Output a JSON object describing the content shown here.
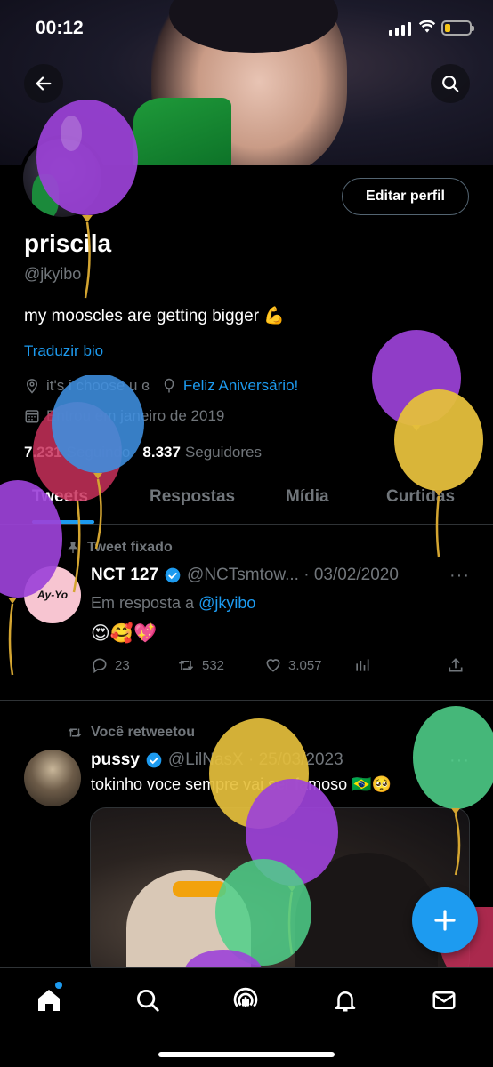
{
  "status_bar": {
    "time": "00:12"
  },
  "profile": {
    "edit_label": "Editar perfil",
    "name": "priscila",
    "handle": "@jkyibo",
    "bio": "my mooscles are getting bigger 💪",
    "translate_label": "Traduzir bio",
    "location": "it's i choose u ɞ",
    "birthday": "Feliz Aniversário!",
    "joined": "Entrou em janeiro de 2019",
    "following_count": "7.231",
    "following_label": "Seguindo",
    "followers_count": "8.337",
    "followers_label": "Seguidores"
  },
  "tabs": [
    "Tweets",
    "Respostas",
    "Mídia",
    "Curtidas"
  ],
  "posts": [
    {
      "context": "Tweet fixado",
      "avatar_text": "Ay-Yo",
      "name": "NCT 127",
      "handle_date": "@NCTsmtow... · 03/02/2020",
      "reply_prefix": "Em resposta a",
      "reply_handle": "@jkyibo",
      "text": "😍🥰💖",
      "replies": "23",
      "retweets": "532",
      "likes": "3.057"
    },
    {
      "context": "Você retweetou",
      "name": "pussy",
      "handle_date": "@LilNasX · 25/03/2023",
      "text": "tokinho voce sempre vai ser famoso 🇧🇷🥺"
    }
  ],
  "colors": {
    "accent": "#1d9bf0",
    "background": "#000000"
  }
}
